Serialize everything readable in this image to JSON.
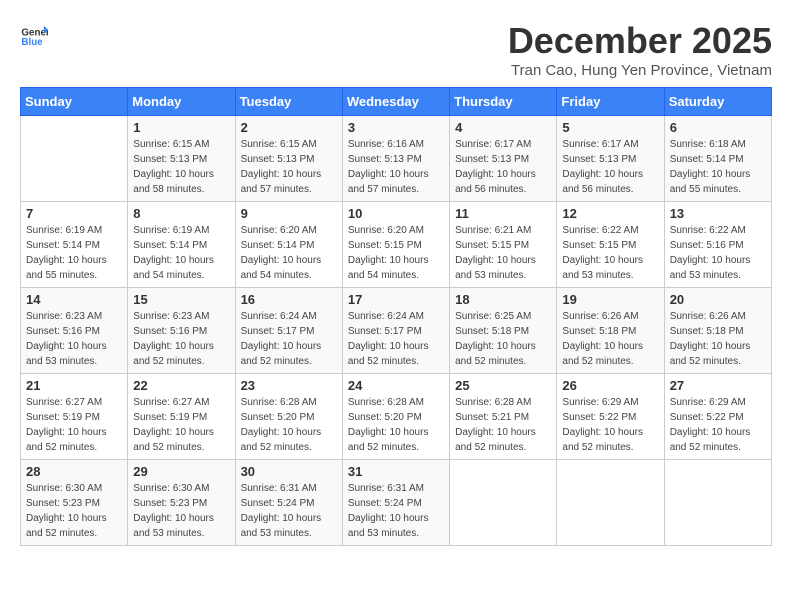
{
  "logo": {
    "general": "General",
    "blue": "Blue"
  },
  "title": "December 2025",
  "location": "Tran Cao, Hung Yen Province, Vietnam",
  "days_header": [
    "Sunday",
    "Monday",
    "Tuesday",
    "Wednesday",
    "Thursday",
    "Friday",
    "Saturday"
  ],
  "weeks": [
    [
      {
        "day": "",
        "info": ""
      },
      {
        "day": "1",
        "info": "Sunrise: 6:15 AM\nSunset: 5:13 PM\nDaylight: 10 hours\nand 58 minutes."
      },
      {
        "day": "2",
        "info": "Sunrise: 6:15 AM\nSunset: 5:13 PM\nDaylight: 10 hours\nand 57 minutes."
      },
      {
        "day": "3",
        "info": "Sunrise: 6:16 AM\nSunset: 5:13 PM\nDaylight: 10 hours\nand 57 minutes."
      },
      {
        "day": "4",
        "info": "Sunrise: 6:17 AM\nSunset: 5:13 PM\nDaylight: 10 hours\nand 56 minutes."
      },
      {
        "day": "5",
        "info": "Sunrise: 6:17 AM\nSunset: 5:13 PM\nDaylight: 10 hours\nand 56 minutes."
      },
      {
        "day": "6",
        "info": "Sunrise: 6:18 AM\nSunset: 5:14 PM\nDaylight: 10 hours\nand 55 minutes."
      }
    ],
    [
      {
        "day": "7",
        "info": "Sunrise: 6:19 AM\nSunset: 5:14 PM\nDaylight: 10 hours\nand 55 minutes."
      },
      {
        "day": "8",
        "info": "Sunrise: 6:19 AM\nSunset: 5:14 PM\nDaylight: 10 hours\nand 54 minutes."
      },
      {
        "day": "9",
        "info": "Sunrise: 6:20 AM\nSunset: 5:14 PM\nDaylight: 10 hours\nand 54 minutes."
      },
      {
        "day": "10",
        "info": "Sunrise: 6:20 AM\nSunset: 5:15 PM\nDaylight: 10 hours\nand 54 minutes."
      },
      {
        "day": "11",
        "info": "Sunrise: 6:21 AM\nSunset: 5:15 PM\nDaylight: 10 hours\nand 53 minutes."
      },
      {
        "day": "12",
        "info": "Sunrise: 6:22 AM\nSunset: 5:15 PM\nDaylight: 10 hours\nand 53 minutes."
      },
      {
        "day": "13",
        "info": "Sunrise: 6:22 AM\nSunset: 5:16 PM\nDaylight: 10 hours\nand 53 minutes."
      }
    ],
    [
      {
        "day": "14",
        "info": "Sunrise: 6:23 AM\nSunset: 5:16 PM\nDaylight: 10 hours\nand 53 minutes."
      },
      {
        "day": "15",
        "info": "Sunrise: 6:23 AM\nSunset: 5:16 PM\nDaylight: 10 hours\nand 52 minutes."
      },
      {
        "day": "16",
        "info": "Sunrise: 6:24 AM\nSunset: 5:17 PM\nDaylight: 10 hours\nand 52 minutes."
      },
      {
        "day": "17",
        "info": "Sunrise: 6:24 AM\nSunset: 5:17 PM\nDaylight: 10 hours\nand 52 minutes."
      },
      {
        "day": "18",
        "info": "Sunrise: 6:25 AM\nSunset: 5:18 PM\nDaylight: 10 hours\nand 52 minutes."
      },
      {
        "day": "19",
        "info": "Sunrise: 6:26 AM\nSunset: 5:18 PM\nDaylight: 10 hours\nand 52 minutes."
      },
      {
        "day": "20",
        "info": "Sunrise: 6:26 AM\nSunset: 5:18 PM\nDaylight: 10 hours\nand 52 minutes."
      }
    ],
    [
      {
        "day": "21",
        "info": "Sunrise: 6:27 AM\nSunset: 5:19 PM\nDaylight: 10 hours\nand 52 minutes."
      },
      {
        "day": "22",
        "info": "Sunrise: 6:27 AM\nSunset: 5:19 PM\nDaylight: 10 hours\nand 52 minutes."
      },
      {
        "day": "23",
        "info": "Sunrise: 6:28 AM\nSunset: 5:20 PM\nDaylight: 10 hours\nand 52 minutes."
      },
      {
        "day": "24",
        "info": "Sunrise: 6:28 AM\nSunset: 5:20 PM\nDaylight: 10 hours\nand 52 minutes."
      },
      {
        "day": "25",
        "info": "Sunrise: 6:28 AM\nSunset: 5:21 PM\nDaylight: 10 hours\nand 52 minutes."
      },
      {
        "day": "26",
        "info": "Sunrise: 6:29 AM\nSunset: 5:22 PM\nDaylight: 10 hours\nand 52 minutes."
      },
      {
        "day": "27",
        "info": "Sunrise: 6:29 AM\nSunset: 5:22 PM\nDaylight: 10 hours\nand 52 minutes."
      }
    ],
    [
      {
        "day": "28",
        "info": "Sunrise: 6:30 AM\nSunset: 5:23 PM\nDaylight: 10 hours\nand 52 minutes."
      },
      {
        "day": "29",
        "info": "Sunrise: 6:30 AM\nSunset: 5:23 PM\nDaylight: 10 hours\nand 53 minutes."
      },
      {
        "day": "30",
        "info": "Sunrise: 6:31 AM\nSunset: 5:24 PM\nDaylight: 10 hours\nand 53 minutes."
      },
      {
        "day": "31",
        "info": "Sunrise: 6:31 AM\nSunset: 5:24 PM\nDaylight: 10 hours\nand 53 minutes."
      },
      {
        "day": "",
        "info": ""
      },
      {
        "day": "",
        "info": ""
      },
      {
        "day": "",
        "info": ""
      }
    ]
  ]
}
